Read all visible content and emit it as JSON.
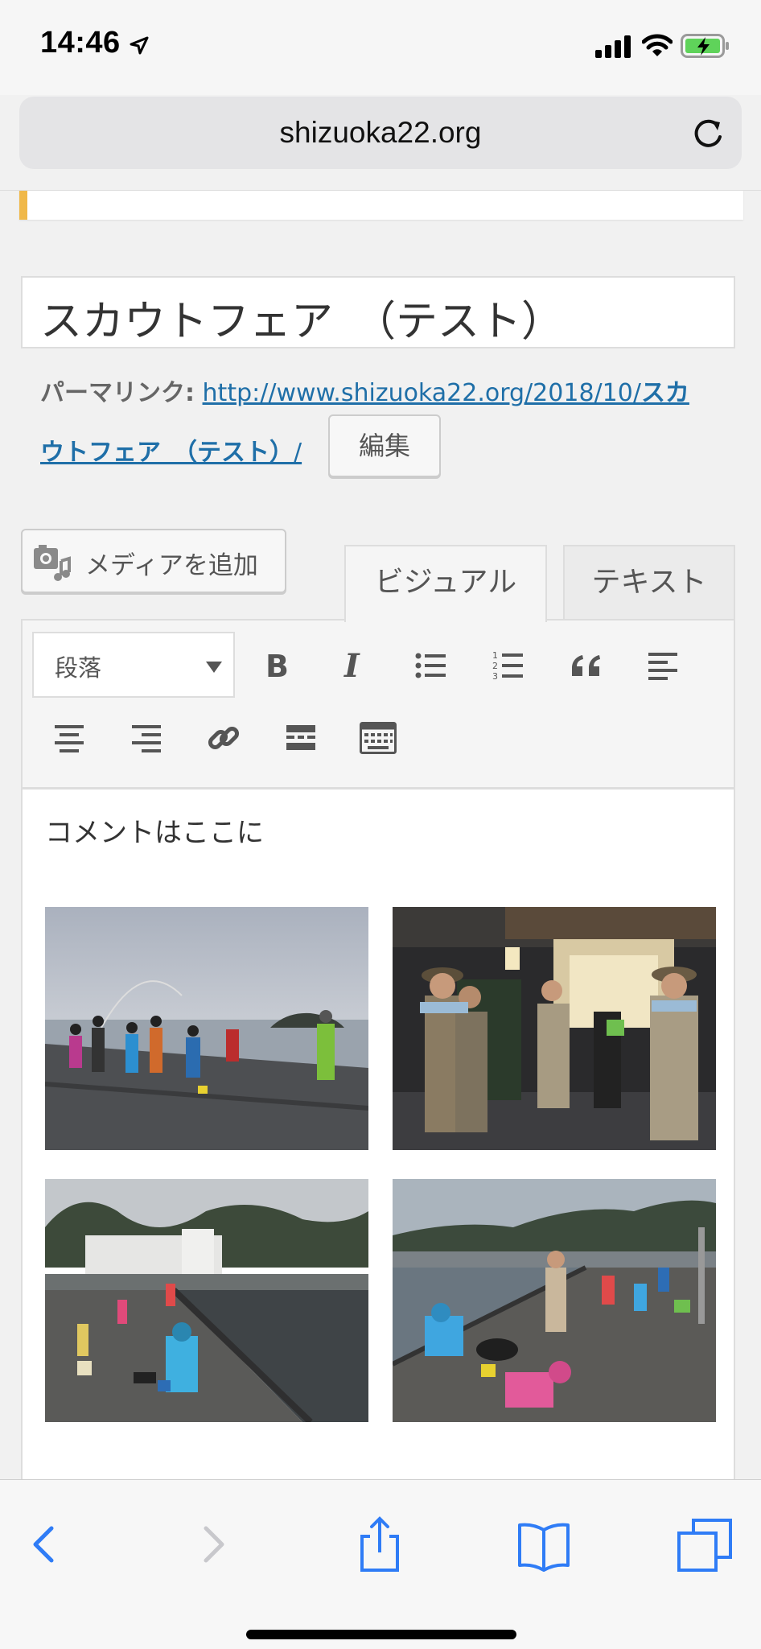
{
  "status_bar": {
    "time": "14:46"
  },
  "browser": {
    "url": "shizuoka22.org"
  },
  "editor": {
    "post_title": "スカウトフェア　（テスト）",
    "permalink_label": "パーマリンク:",
    "permalink_url_part1": "http://www.shizuoka22.org/2018/10/",
    "permalink_slug_part1": "スカ",
    "permalink_slug_part2": "ウトフェア　（テスト）",
    "permalink_trailing": "/",
    "edit_button": "編集",
    "add_media_button": "メディアを追加",
    "tabs": [
      {
        "label": "ビジュアル",
        "active": true
      },
      {
        "label": "テキスト",
        "active": false
      }
    ],
    "format_select": "段落",
    "toolbar_icons": [
      "bold-icon",
      "italic-icon",
      "bullet-list-icon",
      "numbered-list-icon",
      "blockquote-icon",
      "align-left-icon",
      "align-center-icon",
      "align-right-icon",
      "link-icon",
      "read-more-icon",
      "toolbar-toggle-icon"
    ],
    "content_text": "コメントはここに",
    "photos": [
      "fishing-pier-photo",
      "scouts-evening-photo",
      "harbor-mountains-photo",
      "kids-fishing-photo"
    ]
  },
  "colors": {
    "link": "#1f6fa8",
    "notice_accent": "#f0b849",
    "ios_blue": "#2f7cf6"
  }
}
